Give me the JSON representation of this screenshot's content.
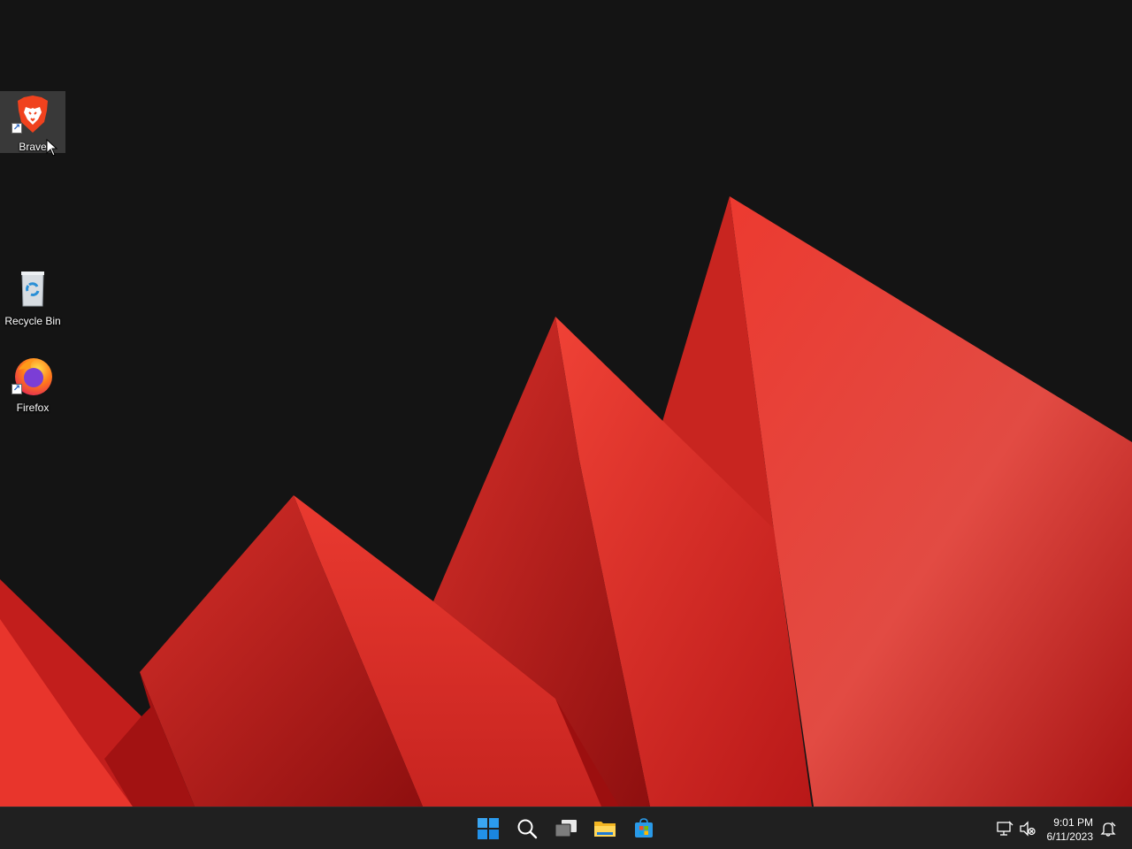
{
  "desktop": {
    "icons": [
      {
        "label": "Brave",
        "icon": "brave-lion-icon",
        "shortcut": true,
        "selected": true
      },
      {
        "label": "Recycle Bin",
        "icon": "recycle-bin-icon",
        "shortcut": false,
        "selected": false
      },
      {
        "label": "Firefox",
        "icon": "firefox-icon",
        "shortcut": true,
        "selected": false
      }
    ],
    "wallpaper": {
      "background": "#141414",
      "accent": "#e53a2f"
    }
  },
  "taskbar": {
    "buttons": [
      {
        "name": "start-button",
        "icon": "windows-logo-icon"
      },
      {
        "name": "search-button",
        "icon": "search-icon"
      },
      {
        "name": "task-view-button",
        "icon": "task-view-icon"
      },
      {
        "name": "file-explorer-button",
        "icon": "folder-icon"
      },
      {
        "name": "microsoft-store-button",
        "icon": "store-icon"
      }
    ],
    "tray": {
      "icons": [
        "network-icon",
        "volume-muted-icon",
        "notification-icon"
      ],
      "time": "9:01 PM",
      "date": "6/11/2023"
    }
  }
}
